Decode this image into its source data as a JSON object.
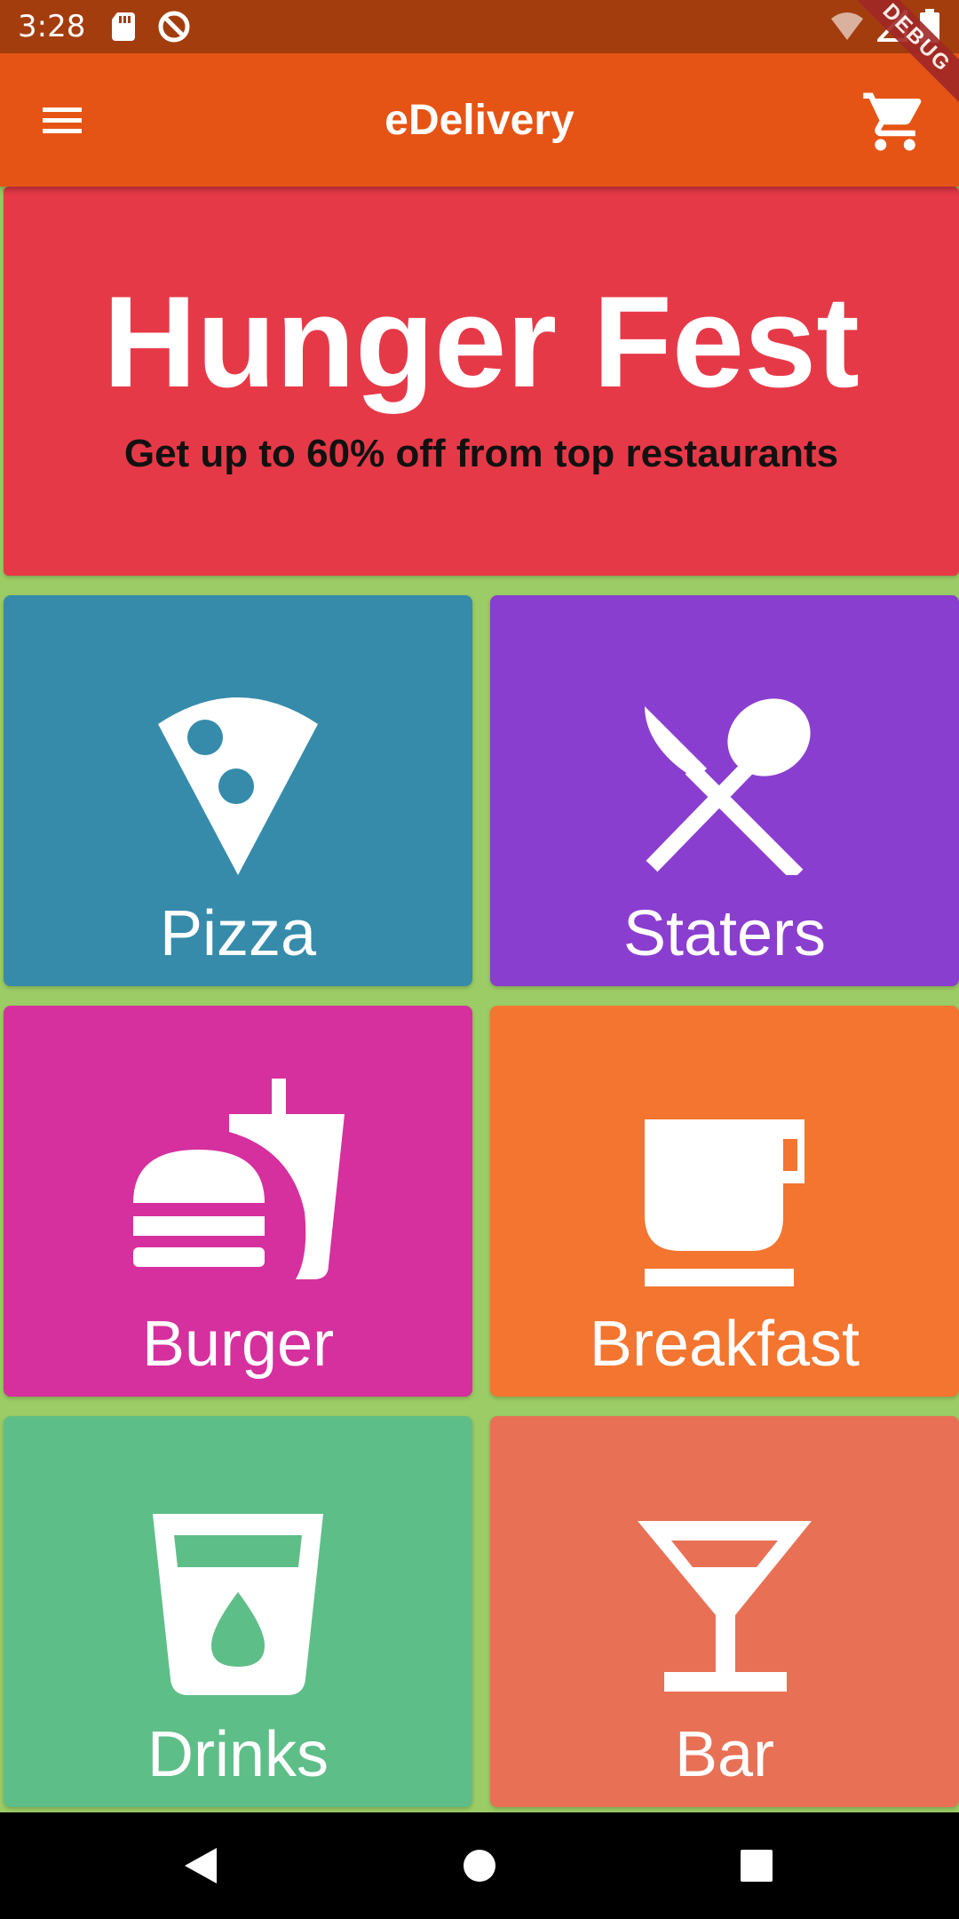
{
  "status_bar": {
    "time": "3:28",
    "icons": [
      "sd-card-icon",
      "sync-disabled-icon",
      "wifi-off-icon",
      "signal-icon",
      "battery-icon"
    ]
  },
  "debug_ribbon": "DEBUG",
  "app_bar": {
    "title": "eDelivery",
    "menu_icon": "menu-icon",
    "cart_icon": "cart-icon"
  },
  "banner": {
    "title": "Hunger Fest",
    "subtitle": "Get up to 60% off from top restaurants"
  },
  "categories": [
    {
      "label": "Pizza",
      "icon": "pizza-icon",
      "color": "#368baa"
    },
    {
      "label": "Staters",
      "icon": "cutlery-icon",
      "color": "#8a3ecf"
    },
    {
      "label": "Burger",
      "icon": "burger-drink-icon",
      "color": "#d5309e"
    },
    {
      "label": "Breakfast",
      "icon": "coffee-cup-icon",
      "color": "#f3752f"
    },
    {
      "label": "Drinks",
      "icon": "drink-glass-icon",
      "color": "#5ebe88"
    },
    {
      "label": "Bar",
      "icon": "cocktail-icon",
      "color": "#e87055"
    }
  ],
  "nav_bar": {
    "buttons": [
      "back-icon",
      "home-icon",
      "recents-icon"
    ]
  },
  "colors": {
    "status_bar": "#a33d0e",
    "app_bar": "#e55414",
    "banner": "#e63948",
    "background": "#9ccc65"
  }
}
